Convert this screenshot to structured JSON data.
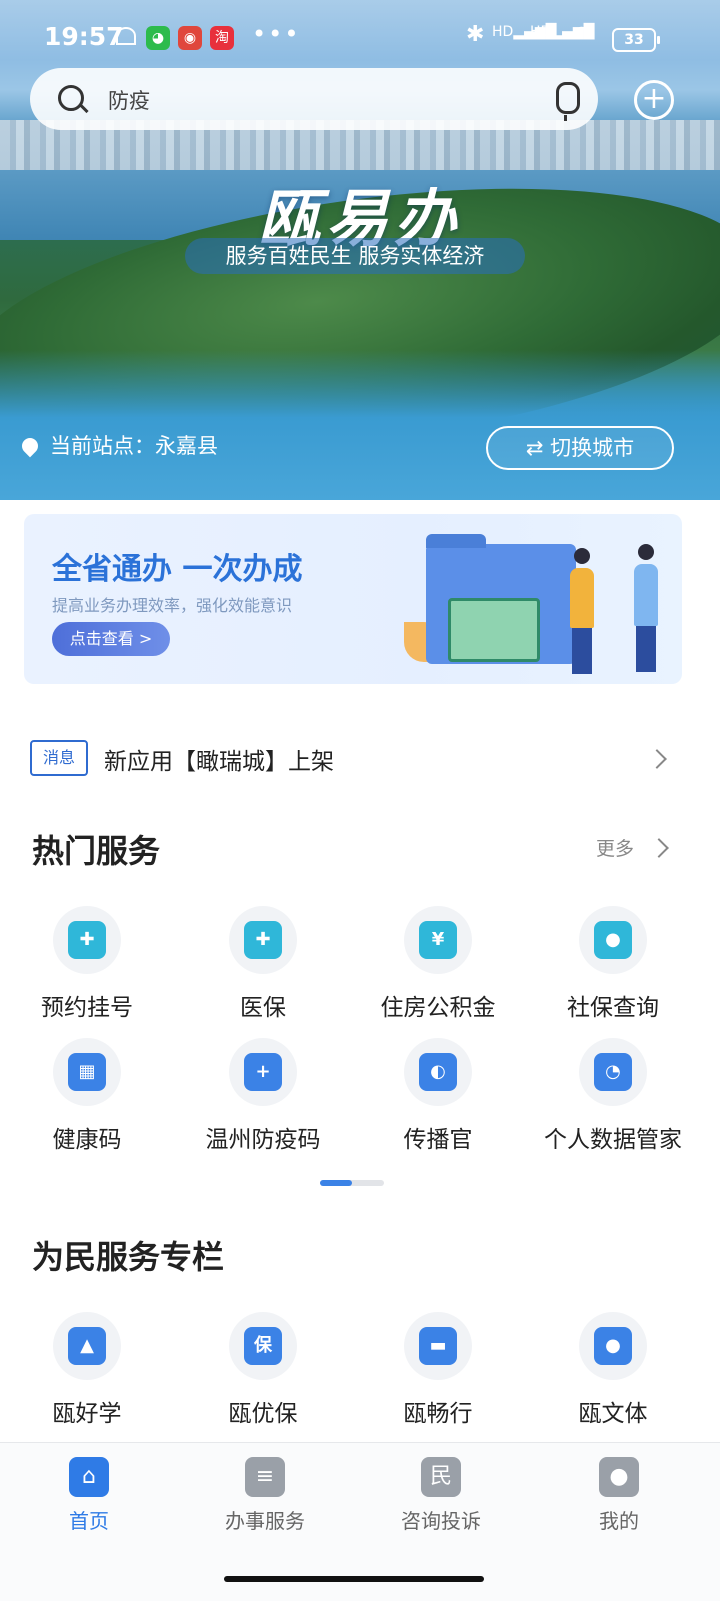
{
  "status_bar": {
    "time": "19:57",
    "battery": "33",
    "network_label": "HD"
  },
  "search": {
    "query": "防疫"
  },
  "hero": {
    "brand": "瓯易办",
    "slogan": "服务百姓民生  服务实体经济",
    "station_label": "当前站点：永嘉县",
    "switch_city": "切换城市"
  },
  "banner": {
    "title": "全省通办 一次办成",
    "subtitle": "提高业务办理效率，强化效能意识",
    "cta": "点击查看 >"
  },
  "message": {
    "tag": "消息",
    "text": "新应用【瞰瑞城】上架"
  },
  "hot_services": {
    "title": "热门服务",
    "more": "更多",
    "items": [
      {
        "label": "预约挂号",
        "icon": "calendar-plus-icon",
        "color": "#2fb7d9"
      },
      {
        "label": "医保",
        "icon": "medical-insurance-icon",
        "color": "#2fb7d9"
      },
      {
        "label": "住房公积金",
        "icon": "house-yuan-icon",
        "color": "#2fb7d9"
      },
      {
        "label": "社保查询",
        "icon": "shield-user-icon",
        "color": "#2fb7d9"
      },
      {
        "label": "健康码",
        "icon": "qr-code-icon",
        "color": "#3b82e6"
      },
      {
        "label": "温州防疫码",
        "icon": "shield-plus-icon",
        "color": "#3b82e6"
      },
      {
        "label": "传播官",
        "icon": "megaphone-user-icon",
        "color": "#3b82e6"
      },
      {
        "label": "个人数据管家",
        "icon": "pie-user-icon",
        "color": "#3b82e6"
      }
    ]
  },
  "people_services": {
    "title": "为民服务专栏",
    "items": [
      {
        "label": "瓯好学",
        "icon": "graduation-cap-icon",
        "color": "#3b82e6"
      },
      {
        "label": "瓯优保",
        "icon": "shield-bao-icon",
        "color": "#3b82e6"
      },
      {
        "label": "瓯畅行",
        "icon": "car-icon",
        "color": "#3b82e6"
      },
      {
        "label": "瓯文体",
        "icon": "ping-pong-icon",
        "color": "#3b82e6"
      }
    ]
  },
  "tabs": [
    {
      "label": "首页",
      "icon": "home-icon",
      "active": true
    },
    {
      "label": "办事服务",
      "icon": "document-clock-icon",
      "active": false
    },
    {
      "label": "咨询投诉",
      "icon": "min-hu-wo-wei-icon",
      "active": false
    },
    {
      "label": "我的",
      "icon": "user-icon",
      "active": false
    }
  ],
  "colors": {
    "accent": "#3b82e6",
    "tab_active": "#2f7be6"
  }
}
